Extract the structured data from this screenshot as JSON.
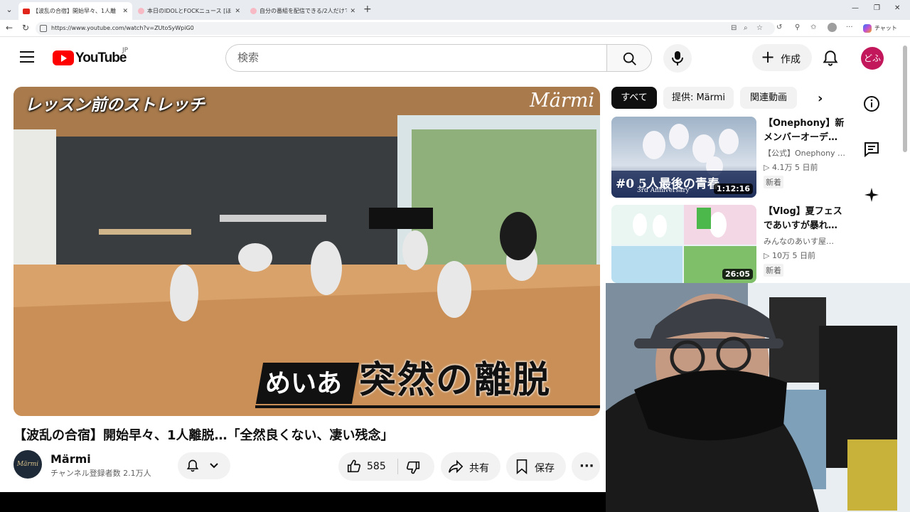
{
  "browser": {
    "tabs": [
      {
        "title": "【波乱の合宿】開始早々、1人離"
      },
      {
        "title": "本日のIDOLとFOCKニュース [ほとん"
      },
      {
        "title": "自分の番組を配信できる/2人だけで"
      }
    ],
    "url": "https://www.youtube.com/watch?v=ZUtoSyWpiG0",
    "chat_label": "チャット"
  },
  "masthead": {
    "logo_text": "YouTube",
    "country": "JP",
    "search_placeholder": "検索",
    "create_label": "作成",
    "avatar_text": "どふ"
  },
  "video": {
    "thumb_caption_top": "レッスン前のストレッチ",
    "thumb_brand": "Märmi",
    "thumb_name": "めいあ",
    "thumb_headline": "突然の離脱",
    "title": "【波乱の合宿】開始早々、1人離脱…「全然良くない、凄い残念」"
  },
  "channel": {
    "avatar_text": "Märmi",
    "name": "Märmi",
    "subscribers": "チャンネル登録者数 2.1万人"
  },
  "actions": {
    "like_count": "585",
    "share_label": "共有",
    "save_label": "保存"
  },
  "chips": [
    {
      "label": "すべて"
    },
    {
      "label": "提供: Märmi"
    },
    {
      "label": "関連動画"
    }
  ],
  "recommendations": [
    {
      "title": "【Onephony】新メンバーオーデ…",
      "channel": "【公式】Onephony …",
      "meta": "▷ 4.1万  5 日前",
      "badge": "新着",
      "duration": "1:12:16",
      "thumb_text": "#0 5人最後の青春",
      "thumb_sub": "3rd Anniversary"
    },
    {
      "title": "【Vlog】夏フェスであいすが暴れ…",
      "channel": "みんなのあいす屋…",
      "meta": "▷ 10万  5 日前",
      "badge": "新着",
      "duration": "26:05"
    }
  ]
}
